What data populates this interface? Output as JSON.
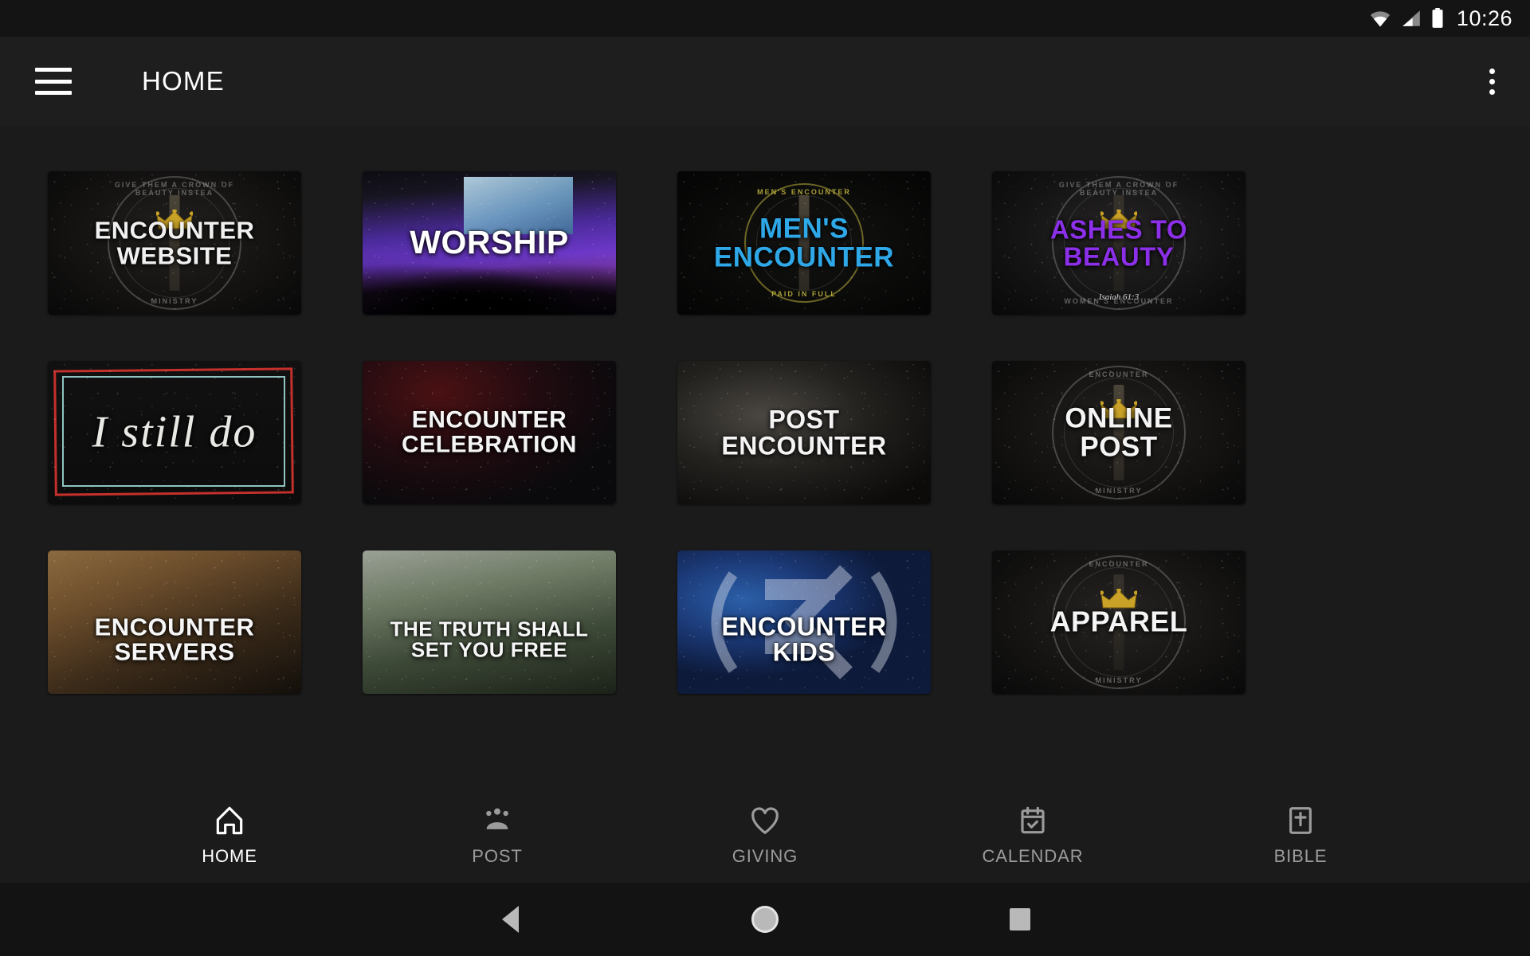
{
  "status_bar": {
    "time": "10:26",
    "icons": [
      "wifi-icon",
      "cellular-signal-icon",
      "battery-icon"
    ]
  },
  "app_bar": {
    "menu_icon": "hamburger-menu-icon",
    "title": "HOME",
    "overflow_icon": "more-vertical-icon"
  },
  "colors": {
    "background": "#1b1b1b",
    "app_bar": "#1e1e1e",
    "status_bar": "#141414",
    "active_nav": "#ffffff",
    "inactive_nav": "#9b9b9b",
    "mens_encounter_blue": "#2fa8e8",
    "ashes_purple": "#8b2fe8",
    "crown_gold": "#c9a227",
    "i_still_do_red": "#c4302b",
    "i_still_do_teal": "#8fc4c0"
  },
  "grid": {
    "tiles": [
      {
        "id": "encounter-website",
        "label": "ENCOUNTER\nWEBSITE",
        "line1": "ENCOUNTER",
        "line2": "WEBSITE",
        "style": "seal-dark",
        "seal_top": "GIVE THEM A CROWN OF BEAUTY INSTEAD OF",
        "seal_bottom": "MINISTRY",
        "text_color": "#f0f0f0",
        "font_size": 31
      },
      {
        "id": "worship",
        "label": "WORSHIP",
        "line1": "WORSHIP",
        "line2": "",
        "style": "worship-purple",
        "text_color": "#ffffff",
        "font_size": 41
      },
      {
        "id": "mens-encounter",
        "label": "MEN'S\nENCOUNTER",
        "line1": "MEN'S",
        "line2": "ENCOUNTER",
        "style": "mens-blue",
        "seal_top": "MEN'S ENCOUNTER",
        "seal_bottom": "PAID IN FULL",
        "text_color": "#2fa8e8",
        "font_size": 35
      },
      {
        "id": "ashes-to-beauty",
        "label": "ASHES TO\nBEAUTY",
        "line1": "ASHES TO",
        "line2": "BEAUTY",
        "style": "ashes-purple",
        "seal_top": "GIVE THEM A CROWN OF BEAUTY INSTEAD OF ASHES",
        "seal_bottom": "WOMEN'S ENCOUNTER",
        "verse": "Isaiah 61:3",
        "text_color": "#8b2fe8",
        "font_size": 33
      },
      {
        "id": "i-still-do",
        "label": "I still do",
        "line1": "I still do",
        "line2": "",
        "style": "i-still-do",
        "text_color": "#e8e8e4",
        "font_size": 56
      },
      {
        "id": "encounter-celebration",
        "label": "ENCOUNTER\nCELEBRATION",
        "line1": "ENCOUNTER",
        "line2": "CELEBRATION",
        "style": "celebration-red",
        "text_color": "#f4f4f4",
        "font_size": 30
      },
      {
        "id": "post-encounter",
        "label": "POST\nENCOUNTER",
        "line1": "POST",
        "line2": "ENCOUNTER",
        "style": "post-hands",
        "text_color": "#f4f4f4",
        "font_size": 32
      },
      {
        "id": "online-post",
        "label": "ONLINE\nPOST",
        "line1": "ONLINE",
        "line2": "POST",
        "style": "seal-dark",
        "seal_top": "ENCOUNTER",
        "seal_bottom": "MINISTRY",
        "text_color": "#f4f4f4",
        "font_size": 35
      },
      {
        "id": "encounter-servers",
        "label": "ENCOUNTER\nSERVERS",
        "line1": "ENCOUNTER",
        "line2": "SERVERS",
        "style": "servers-warm",
        "text_color": "#f6f6f6",
        "font_size": 31
      },
      {
        "id": "truth-shall-set-you-free",
        "label": "THE TRUTH SHALL\nSET YOU FREE",
        "line1": "THE TRUTH SHALL",
        "line2": "SET YOU FREE",
        "style": "forest",
        "text_color": "#f6f6f6",
        "font_size": 26
      },
      {
        "id": "encounter-kids",
        "label": "ENCOUNTER\nKIDS",
        "line1": "ENCOUNTER",
        "line2": "KIDS",
        "style": "kids-galaxy",
        "text_color": "#ffffff",
        "font_size": 32
      },
      {
        "id": "apparel",
        "label": "APPAREL",
        "line1": "APPAREL",
        "line2": "",
        "style": "apparel-dark",
        "seal_top": "ENCOUNTER",
        "seal_bottom": "MINISTRY",
        "text_color": "#f4f4f4",
        "font_size": 36
      }
    ]
  },
  "bottom_nav": {
    "items": [
      {
        "id": "home",
        "label": "HOME",
        "icon": "home-icon",
        "active": true
      },
      {
        "id": "post",
        "label": "POST",
        "icon": "people-icon",
        "active": false
      },
      {
        "id": "giving",
        "label": "GIVING",
        "icon": "heart-icon",
        "active": false
      },
      {
        "id": "calendar",
        "label": "CALENDAR",
        "icon": "calendar-check-icon",
        "active": false
      },
      {
        "id": "bible",
        "label": "BIBLE",
        "icon": "bible-book-icon",
        "active": false
      }
    ]
  },
  "system_nav": {
    "back": "back-triangle-icon",
    "home": "home-circle-icon",
    "recents": "recents-square-icon"
  }
}
